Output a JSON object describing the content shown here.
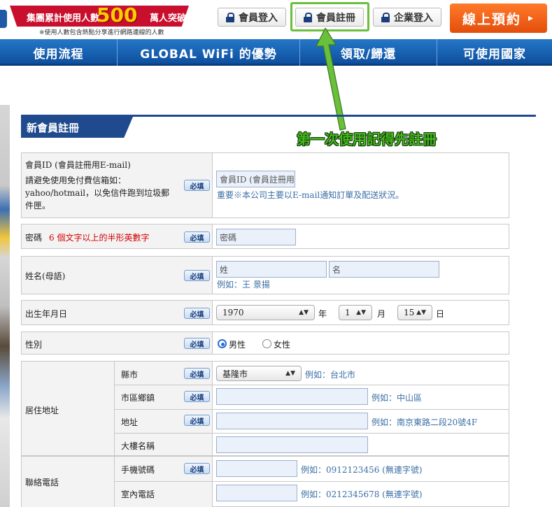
{
  "header": {
    "banner_line1_prefix": "集團累計使用人數",
    "banner_number": "500",
    "banner_line1_suffix": "萬人突破",
    "banner_note": "※使用人數包含熱點分享進行網路連線的人數",
    "buttons": [
      {
        "label": "會員登入",
        "icon": "lock-icon"
      },
      {
        "label": "會員註冊",
        "icon": "lock-icon"
      },
      {
        "label": "企業登入",
        "icon": "lock-icon"
      }
    ],
    "reserve_label": "線上預約",
    "reserve_arrow": "▸"
  },
  "nav": {
    "items": [
      "使用流程",
      "GLOBAL WiFi 的優勢",
      "領取/歸還",
      "可使用國家"
    ]
  },
  "annotation": {
    "callout": "第一次使用記得先註冊",
    "highlight_color": "#6abf3b"
  },
  "form": {
    "title": "新會員註冊",
    "required_label": "必填",
    "email": {
      "label": "會員ID (會員註冊用E-mail)",
      "note": "請避免使用免付費信箱如：yahoo/hotmail，以免信件跑到垃圾郵件匣。",
      "placeholder": "會員ID (會員註冊用E-mail)",
      "hint": "重要※本公司主要以E-mail通知訂單及配送狀況。"
    },
    "password": {
      "label": "密碼",
      "rule": "6 個文字以上的半形英數字",
      "placeholder": "密碼"
    },
    "name": {
      "label": "姓名(母語)",
      "last_placeholder": "姓",
      "first_placeholder": "名",
      "hint": "例如：王 景揚"
    },
    "birthday": {
      "label": "出生年月日",
      "year": "1970",
      "year_unit": "年",
      "month": "1",
      "month_unit": "月",
      "day": "15",
      "day_unit": "日"
    },
    "gender": {
      "label": "性別",
      "male": "男性",
      "female": "女性",
      "selected": "male"
    },
    "address": {
      "label": "居住地址",
      "city_label": "縣市",
      "city_value": "基隆市",
      "city_hint": "例如：台北市",
      "district_label": "市區鄉鎮",
      "district_hint": "例如：中山區",
      "street_label": "地址",
      "street_hint": "例如：南京東路二段20號4F",
      "building_label": "大樓名稱"
    },
    "phone": {
      "label": "聯絡電話",
      "mobile_label": "手機號碼",
      "mobile_hint": "例如：0912123456 (無連字號)",
      "home_label": "室內電話",
      "home_hint": "例如：0212345678 (無連字號)"
    }
  },
  "colors": {
    "nav_blue": "#0e4f9e",
    "title_blue": "#1f4a8e",
    "reserve_orange": "#e44e0c",
    "banner_red": "#c8102e",
    "callout_green": "#47b61f"
  }
}
